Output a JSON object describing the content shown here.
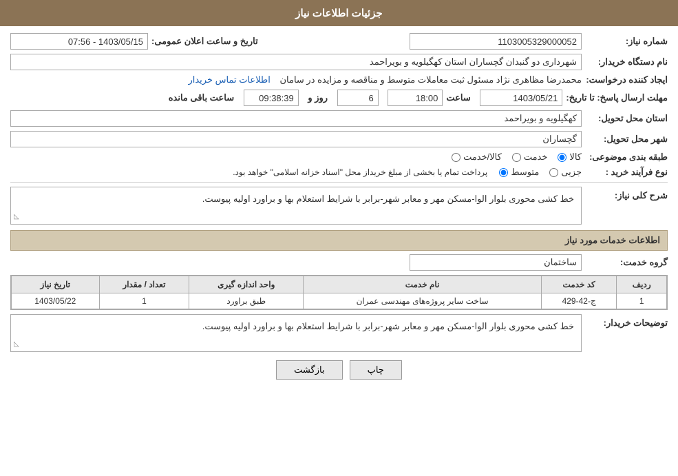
{
  "header": {
    "title": "جزئیات اطلاعات نیاز"
  },
  "fields": {
    "shomareNiaz_label": "شماره نیاز:",
    "shomareNiaz_value": "1103005329000052",
    "namDastgah_label": "نام دستگاه خریدار:",
    "namDastgah_value": "شهرداری دو گنبدان گچساران استان کهگیلویه و بویراحمد",
    "ijadKonande_label": "ایجاد کننده درخواست:",
    "ijadKonande_value": "محمدرضا مظاهری نژاد مسئول ثبت معاملات متوسط و مناقصه و مزایده در سامان",
    "ijadKonande_link": "اطلاعات تماس خریدار",
    "mohlat_label": "مهلت ارسال پاسخ: تا تاریخ:",
    "tarikhAelan_label": "تاریخ و ساعت اعلان عمومی:",
    "tarikhAelan_value": "1403/05/15 - 07:56",
    "tarikhPasokh_value": "1403/05/21",
    "saat_value": "18:00",
    "rooz_value": "6",
    "saatBaqi_value": "09:38:39",
    "ostan_label": "استان محل تحویل:",
    "ostan_value": "کهگیلویه و بویراحمد",
    "shahr_label": "شهر محل تحویل:",
    "shahr_value": "گچساران",
    "tabagheBandi_label": "طبقه بندی موضوعی:",
    "tabagheBandi_kala": "کالا",
    "tabagheBandi_khadamat": "خدمت",
    "tabagheBandi_kala_khadamat": "کالا/خدمت",
    "noeFarayand_label": "نوع فرآیند خرید :",
    "noeFarayand_jazii": "جزیی",
    "noeFarayand_motevasset": "متوسط",
    "noeFarayand_text": "پرداخت تمام یا بخشی از مبلغ خریداز محل \"اسناد خزانه اسلامی\" خواهد بود.",
    "sharhKoli_label": "شرح کلی نیاز:",
    "sharhKoli_value": "خط کشی محوری بلوار الوا-مسکن مهر و معابر شهر-برابر با شرایط استعلام بها و براورد اولیه پیوست.",
    "khadamat_section": "اطلاعات خدمات مورد نیاز",
    "gorohKhadamat_label": "گروه خدمت:",
    "gorohKhadamat_value": "ساختمان",
    "table": {
      "headers": [
        "ردیف",
        "کد خدمت",
        "نام خدمت",
        "واحد اندازه گیری",
        "تعداد / مقدار",
        "تاریخ نیاز"
      ],
      "rows": [
        {
          "radif": "1",
          "kodKhadamat": "ج-42-429",
          "namKhadamat": "ساخت سایر پروژه‌های مهندسی عمران",
          "vahed": "طبق براورد",
          "tedad": "1",
          "tarikh": "1403/05/22"
        }
      ]
    },
    "tosifKharidar_label": "توضیحات خریدار:",
    "tosifKharidar_value": "خط کشی محوری بلوار الوا-مسکن مهر و معابر شهر-برابر با شرایط استعلام بها و براورد اولیه پیوست."
  },
  "buttons": {
    "chap_label": "چاپ",
    "bazgasht_label": "بازگشت"
  },
  "labels": {
    "saat": "ساعت",
    "rooz": "روز و",
    "saatBaqi": "ساعت باقی مانده"
  }
}
